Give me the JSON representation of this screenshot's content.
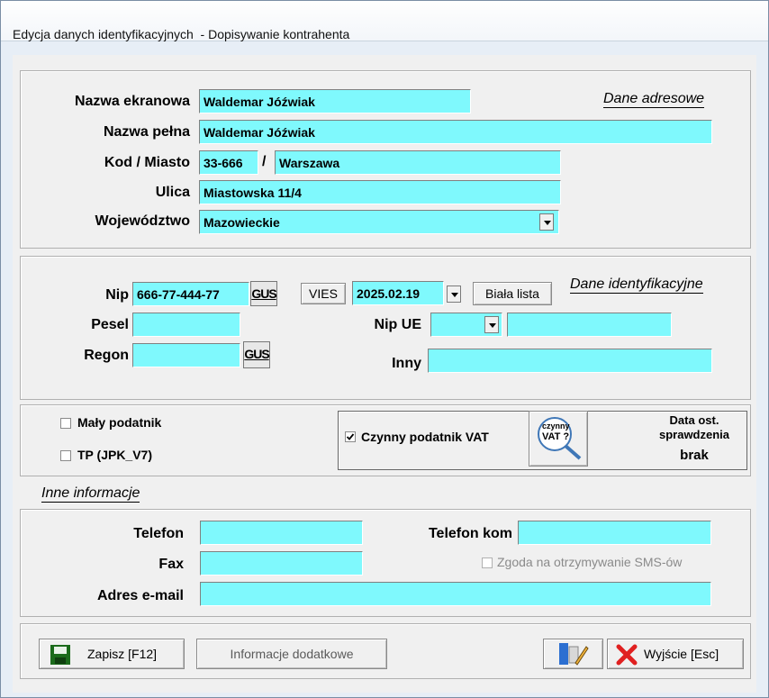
{
  "window": {
    "title": "Edycja danych identyfikacyjnych  - Dopisywanie kontrahenta"
  },
  "address": {
    "section_title": "Dane adresowe",
    "screen_name_label": "Nazwa ekranowa",
    "screen_name": "Waldemar Jóźwiak",
    "full_name_label": "Nazwa pełna",
    "full_name": "Waldemar Jóźwiak",
    "postal_city_label": "Kod / Miasto",
    "postal_code": "33-666",
    "postal_separator": "/",
    "city": "Warszawa",
    "street_label": "Ulica",
    "street": "Miastowska 11/4",
    "voivodeship_label": "Województwo",
    "voivodeship": "Mazowieckie"
  },
  "identification": {
    "section_title": "Dane identyfikacyjne",
    "nip_label": "Nip",
    "nip": "666-77-444-77",
    "gus_label": "GUS",
    "vies_label": "VIES",
    "date": "2025.02.19",
    "white_list_label": "Biała lista",
    "pesel_label": "Pesel",
    "pesel": "",
    "nip_ue_label": "Nip UE",
    "nip_ue_country": "",
    "nip_ue": "",
    "regon_label": "Regon",
    "regon": "",
    "other_label": "Inny",
    "other": ""
  },
  "flags": {
    "small_taxpayer_label": "Mały podatnik",
    "small_taxpayer_checked": false,
    "tp_label": "TP (JPK_V7)",
    "tp_checked": false,
    "active_vat_label": "Czynny podatnik VAT",
    "active_vat_checked": true,
    "vat_check_icon_text1": "czynny",
    "vat_check_icon_text2": "VAT ?",
    "last_check_label": "Data ost. sprawdzenia",
    "last_check_value": "brak"
  },
  "other_info": {
    "section_title": "Inne informacje",
    "phone_label": "Telefon",
    "phone": "",
    "mobile_label": "Telefon kom",
    "mobile": "",
    "fax_label": "Fax",
    "fax": "",
    "sms_consent_label": "Zgoda na otrzymywanie SMS-ów",
    "sms_consent_checked": false,
    "email_label": "Adres e-mail",
    "email": ""
  },
  "footer": {
    "save_label": "Zapisz  [F12]",
    "additional_info_label": "Informacje dodatkowe",
    "exit_label": "Wyjście  [Esc]"
  },
  "colors": {
    "field_bg": "#7ff9fd",
    "save_icon": "#1b6b1b",
    "exit_icon": "#e02020"
  }
}
